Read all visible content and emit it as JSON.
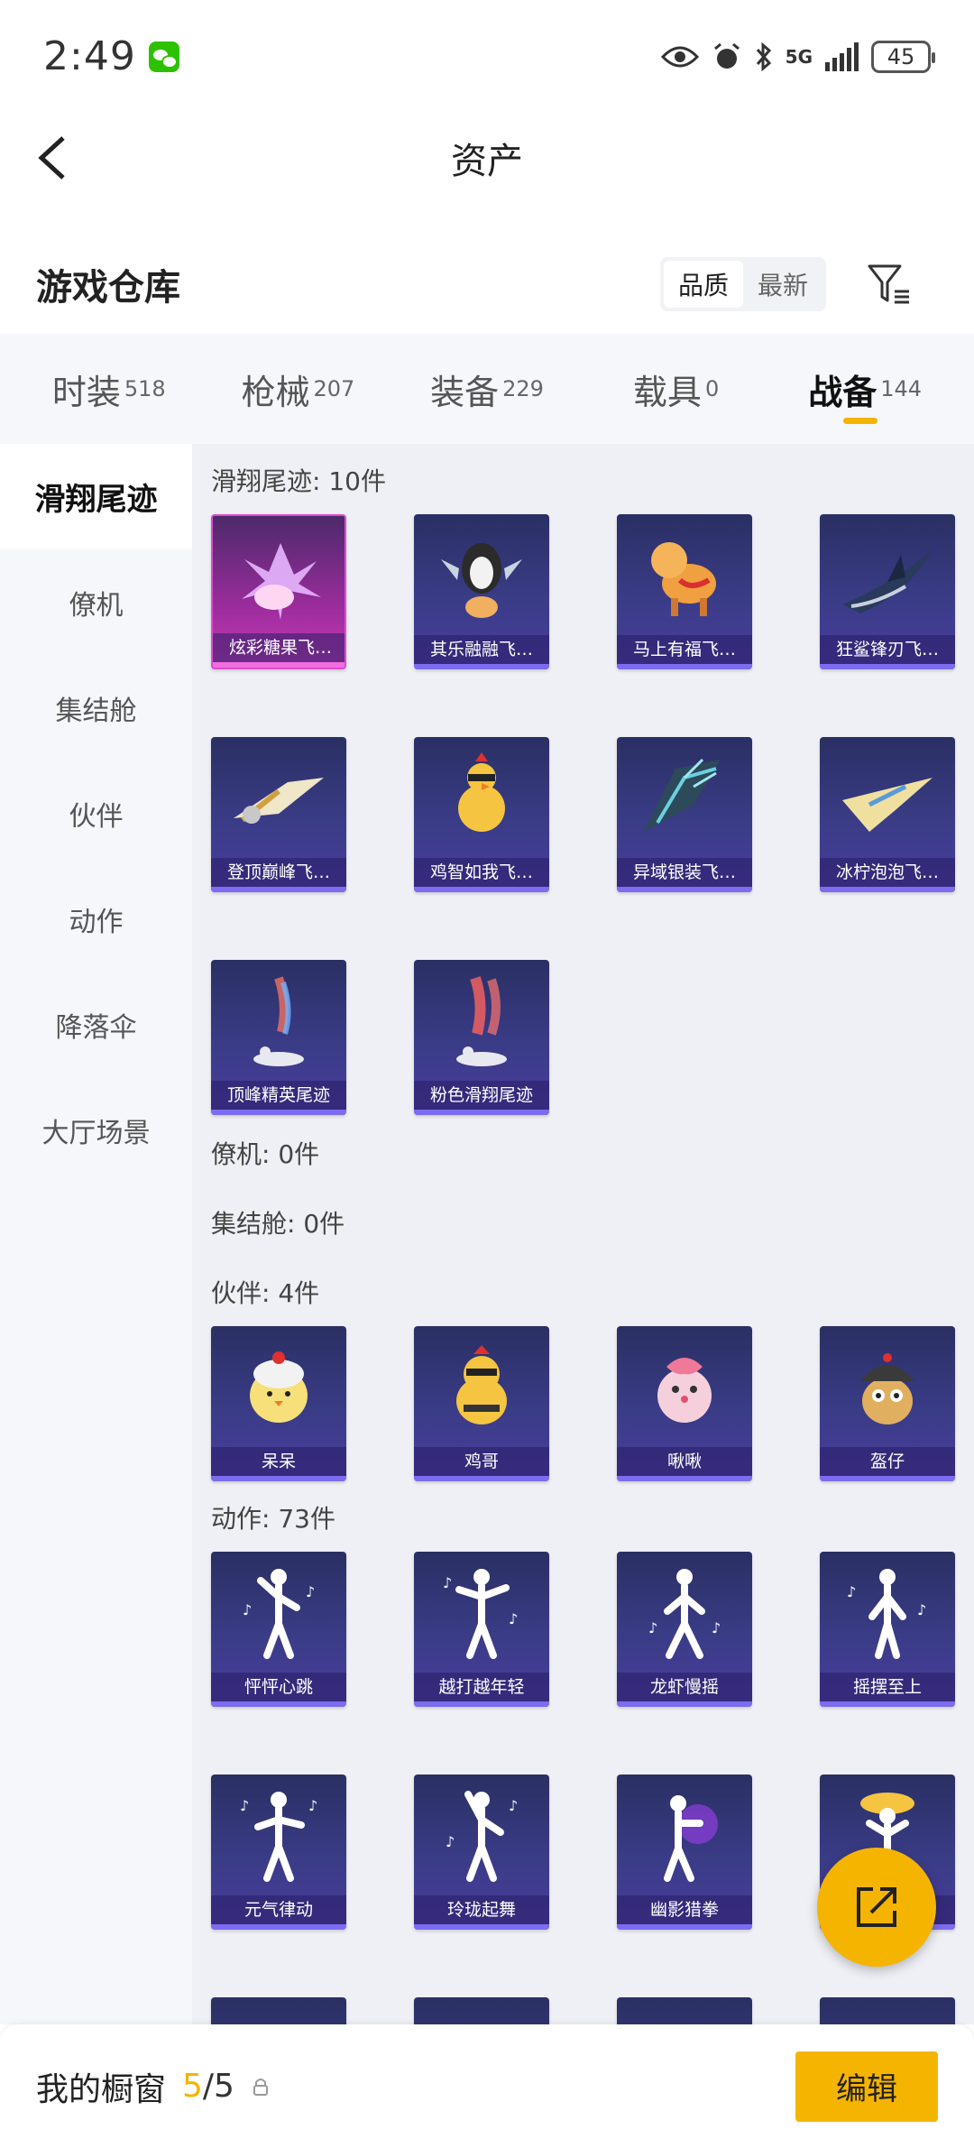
{
  "status_bar": {
    "time": "2:49",
    "network": "5G",
    "battery": "45"
  },
  "header": {
    "title": "资产"
  },
  "warehouse": {
    "title": "游戏仓库",
    "sort_options": [
      {
        "label": "品质",
        "active": true
      },
      {
        "label": "最新",
        "active": false
      }
    ]
  },
  "tabs": [
    {
      "label": "时装",
      "count": "518"
    },
    {
      "label": "枪械",
      "count": "207"
    },
    {
      "label": "装备",
      "count": "229"
    },
    {
      "label": "载具",
      "count": "0"
    },
    {
      "label": "战备",
      "count": "144",
      "active": true
    }
  ],
  "sidenav": [
    {
      "label": "滑翔尾迹",
      "active": true
    },
    {
      "label": "僚机"
    },
    {
      "label": "集结舱"
    },
    {
      "label": "伙伴"
    },
    {
      "label": "动作"
    },
    {
      "label": "降落伞"
    },
    {
      "label": "大厅场景"
    }
  ],
  "sections": {
    "glide": {
      "title": "滑翔尾迹: 10件",
      "items": [
        "炫彩糖果飞…",
        "其乐融融飞…",
        "马上有福飞…",
        "狂鲨锋刃飞…",
        "登顶巅峰飞…",
        "鸡智如我飞…",
        "异域银装飞…",
        "冰柠泡泡飞…",
        "顶峰精英尾迹",
        "粉色滑翔尾迹"
      ]
    },
    "wingman": {
      "title": "僚机: 0件"
    },
    "pod": {
      "title": "集结舱: 0件"
    },
    "partner": {
      "title": "伙伴: 4件",
      "items": [
        "呆呆",
        "鸡哥",
        "啾啾",
        "盔仔"
      ]
    },
    "emote": {
      "title": "动作: 73件",
      "items": [
        "怦怦心跳",
        "越打越年轻",
        "龙虾慢摇",
        "摇摆至上",
        "元气律动",
        "玲珑起舞",
        "幽影猎拳",
        ""
      ]
    }
  },
  "bottom_bar": {
    "title": "我的橱窗",
    "count_current": "5",
    "count_total": "/5",
    "edit_label": "编辑"
  },
  "colors": {
    "accent": "#f5b400",
    "card_bg": "#3a3c87",
    "highlight_card": "#c83bb6"
  }
}
